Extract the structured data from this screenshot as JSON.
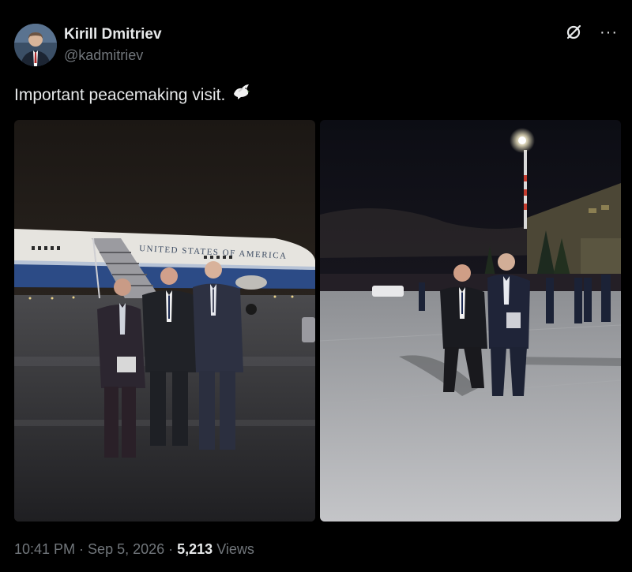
{
  "author": {
    "display_name": "Kirill Dmitriev",
    "handle": "@kadmitriev"
  },
  "tweet": {
    "text": "Important peacemaking visit.",
    "emoji_icon": "dove-icon"
  },
  "media": {
    "left_image": {
      "aircraft_livery": "UNITED STATES OF AMERICA"
    },
    "right_image": {}
  },
  "meta": {
    "time": "10:41 PM",
    "date": "Sep 5, 2026",
    "views_count": "5,213",
    "views_label": "Views",
    "separator": "·"
  },
  "icons": {
    "grok": "grok-icon",
    "more": "more-icon"
  },
  "colors": {
    "background": "#000000",
    "primary_text": "#e7e9ea",
    "secondary_text": "#71767b"
  }
}
